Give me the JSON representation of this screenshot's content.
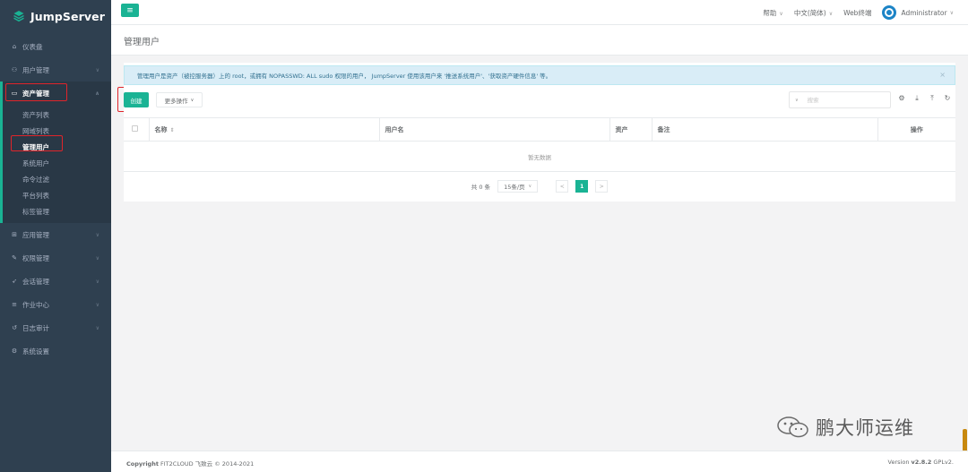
{
  "app": {
    "name": "JumpServer"
  },
  "sidebar": {
    "items": [
      {
        "label": "仪表盘",
        "icon": "dashboard-icon",
        "glyph": "⌂"
      },
      {
        "label": "用户管理",
        "icon": "users-icon",
        "glyph": "⚇",
        "caret": "∨"
      },
      {
        "label": "资产管理",
        "icon": "inbox-icon",
        "glyph": "▭",
        "caret": "∧"
      },
      {
        "label": "应用管理",
        "icon": "grid-icon",
        "glyph": "⊞",
        "caret": "∨"
      },
      {
        "label": "权限管理",
        "icon": "edit-icon",
        "glyph": "✎",
        "caret": "∨"
      },
      {
        "label": "会话管理",
        "icon": "rocket-icon",
        "glyph": "➶",
        "caret": "∨"
      },
      {
        "label": "作业中心",
        "icon": "list-icon",
        "glyph": "≡",
        "caret": "∨"
      },
      {
        "label": "日志审计",
        "icon": "history-icon",
        "glyph": "↺",
        "caret": "∨"
      },
      {
        "label": "系统设置",
        "icon": "cogs-icon",
        "glyph": "⚙"
      }
    ],
    "asset_submenu": [
      "资产列表",
      "网域列表",
      "管理用户",
      "系统用户",
      "命令过滤",
      "平台列表",
      "标签管理"
    ]
  },
  "topbar": {
    "menu_glyph": "≡",
    "help": "帮助",
    "language": "中文(简体)",
    "web_terminal": "Web终端",
    "user": "Administrator",
    "caret": "∨"
  },
  "page": {
    "title": "管理用户"
  },
  "alert": {
    "text": "管理用户是资产（被控服务器）上的 root，或拥有 NOPASSWD: ALL sudo 权限的用户， JumpServer 使用该用户来 '推送系统用户'、'获取资产硬件信息' 等。",
    "close": "×"
  },
  "toolbar": {
    "create": "创建",
    "more_actions": "更多操作",
    "search_placeholder": "搜索",
    "caret": "∨",
    "tool_glyphs": {
      "settings": "⚙",
      "export": "⤓",
      "import": "⤒",
      "refresh": "↻"
    }
  },
  "table": {
    "columns": [
      "名称",
      "用户名",
      "资产",
      "备注",
      "操作"
    ],
    "sort_glyph": "⇕",
    "empty_text": "暂无数据"
  },
  "pagination": {
    "total": "共 0 条",
    "page_size": "15条/页",
    "prev": "<",
    "next": ">",
    "current_page": "1"
  },
  "footer": {
    "copyright_label": "Copyright",
    "copyright_text": "FIT2CLOUD 飞致云 © 2014-2021",
    "version_label": "Version",
    "version": "v2.8.2",
    "license": "GPLv2."
  },
  "watermark": {
    "text": "鹏大师运维"
  },
  "colors": {
    "accent": "#1ab394",
    "sidebar": "#2f4050",
    "highlight": "#e0242a",
    "avatar": "#1c84c6"
  }
}
